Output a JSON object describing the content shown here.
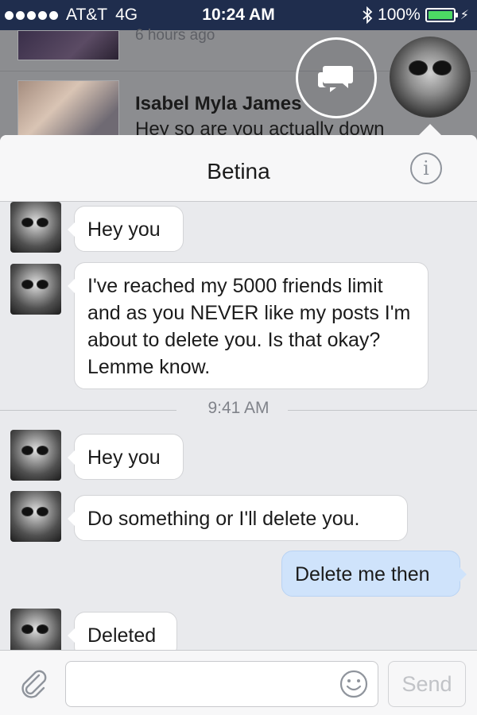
{
  "status_bar": {
    "carrier": "AT&T",
    "network": "4G",
    "time": "10:24 AM",
    "bluetooth_icon": "bluetooth-icon",
    "battery": "100%"
  },
  "feed": {
    "top_subtitle": "6 hours ago",
    "item_name": "Isabel Myla James",
    "item_snippet": "Hey so are you actually down"
  },
  "conversation": {
    "title": "Betina",
    "info_icon": "i",
    "timestamp": "9:41 AM",
    "messages": [
      {
        "direction": "incoming",
        "text": "Hey you"
      },
      {
        "direction": "incoming",
        "text": "I've reached my 5000 friends limit and as you NEVER like my posts I'm about to delete you. Is that okay? Lemme know."
      },
      {
        "direction": "incoming",
        "text": "Hey you"
      },
      {
        "direction": "incoming",
        "text": "Do something or I'll delete you."
      },
      {
        "direction": "outgoing",
        "text": "Delete me then"
      },
      {
        "direction": "incoming",
        "text": "Deleted"
      }
    ]
  },
  "composer": {
    "input_value": "",
    "send_label": "Send"
  },
  "colors": {
    "status_bar_bg": "#1f2d4d",
    "outgoing_bubble": "#cfe3fb",
    "incoming_bubble": "#ffffff",
    "panel_bg": "#e9eaed"
  }
}
